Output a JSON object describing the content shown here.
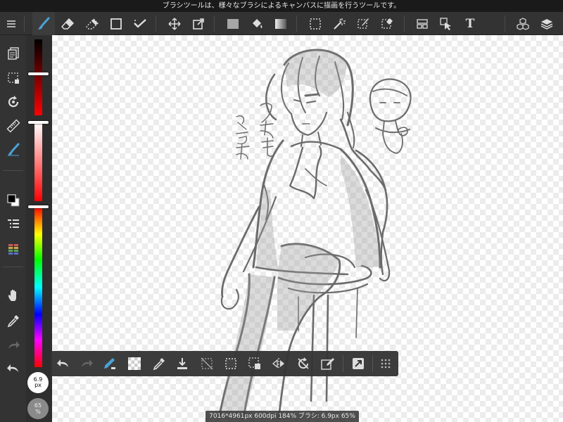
{
  "status_bar": {
    "tooltip": "ブラシツールは、様々なブラシによるキャンバスに描画を行うツールです。"
  },
  "colors": {
    "accent": "#4aa3d8",
    "toolbar_bg": "#333333",
    "icon": "#dddddd",
    "foreground": "#000000",
    "background": "#ffffff"
  },
  "top_toolbar": {
    "tools": [
      {
        "name": "menu",
        "icon": "hamburger-icon"
      },
      {
        "name": "brush",
        "icon": "brush-icon",
        "active": true
      },
      {
        "name": "eraser",
        "icon": "eraser-icon"
      },
      {
        "name": "lasso-eraser",
        "icon": "dotted-eraser-icon"
      },
      {
        "name": "shape",
        "icon": "square-icon"
      },
      {
        "name": "dot-select",
        "icon": "check-dots-icon"
      },
      {
        "name": "move",
        "icon": "move-icon"
      },
      {
        "name": "transform",
        "icon": "transform-icon"
      },
      {
        "name": "fill-color",
        "icon": "gray-square-icon"
      },
      {
        "name": "bucket",
        "icon": "bucket-icon"
      },
      {
        "name": "gradient",
        "icon": "gradient-icon"
      },
      {
        "name": "select",
        "icon": "select-rect-icon"
      },
      {
        "name": "magic-wand",
        "icon": "magic-wand-icon"
      },
      {
        "name": "select-pen",
        "icon": "select-pen-icon"
      },
      {
        "name": "select-eraser",
        "icon": "select-eraser-icon"
      },
      {
        "name": "frame-divider",
        "icon": "panel-icon"
      },
      {
        "name": "operation",
        "icon": "cursor-icon"
      },
      {
        "name": "text",
        "icon": "text-icon",
        "label": "T"
      },
      {
        "name": "materials",
        "icon": "cubes-icon"
      },
      {
        "name": "layers",
        "icon": "layers-icon"
      }
    ]
  },
  "left_toolbar": {
    "items": [
      {
        "name": "pages",
        "icon": "pages-icon"
      },
      {
        "name": "selection",
        "icon": "selection-icon"
      },
      {
        "name": "rotate",
        "icon": "rotate-icon"
      },
      {
        "name": "ruler",
        "icon": "ruler-icon"
      },
      {
        "name": "brush-settings",
        "icon": "brush-settings-icon"
      },
      {
        "name": "color-swap",
        "icon": "color-swap-icon"
      },
      {
        "name": "layer-list",
        "icon": "list-icon"
      },
      {
        "name": "color-history",
        "icon": "color-history-icon"
      },
      {
        "name": "hand",
        "icon": "hand-icon"
      },
      {
        "name": "eyedropper",
        "icon": "eyedropper-icon"
      },
      {
        "name": "redo",
        "icon": "redo-icon"
      },
      {
        "name": "undo",
        "icon": "undo-icon"
      }
    ]
  },
  "color_sliders": {
    "dark_strip_level": 0.45,
    "light_strip_level": 0.0,
    "hue_level": 0.0
  },
  "brush_size": {
    "value": "6.9",
    "unit": "px"
  },
  "opacity": {
    "value": "65",
    "unit": "%"
  },
  "bottom_toolbar": {
    "items": [
      {
        "name": "undo",
        "icon": "undo-icon"
      },
      {
        "name": "redo",
        "icon": "redo-icon"
      },
      {
        "name": "clear",
        "icon": "clear-icon"
      },
      {
        "name": "transparent",
        "icon": "transparent-icon"
      },
      {
        "name": "eyedropper",
        "icon": "eyedropper-icon"
      },
      {
        "name": "save",
        "icon": "download-icon"
      },
      {
        "name": "deselect",
        "icon": "deselect-icon"
      },
      {
        "name": "select-all",
        "icon": "select-all-icon"
      },
      {
        "name": "select-layer",
        "icon": "select-layer-icon"
      },
      {
        "name": "flip",
        "icon": "flip-icon"
      },
      {
        "name": "rotate-reset",
        "icon": "rotate-reset-icon"
      },
      {
        "name": "edit",
        "icon": "edit-icon"
      },
      {
        "name": "quick-action",
        "icon": "quick-action-icon"
      },
      {
        "name": "more",
        "icon": "grid-dots-icon"
      }
    ]
  },
  "info_bar": {
    "text": "7016*4961px 600dpi 184% ブラシ: 6.9px 65%"
  },
  "canvas": {
    "handwritten_note": "ク セ モ / み つ み"
  }
}
